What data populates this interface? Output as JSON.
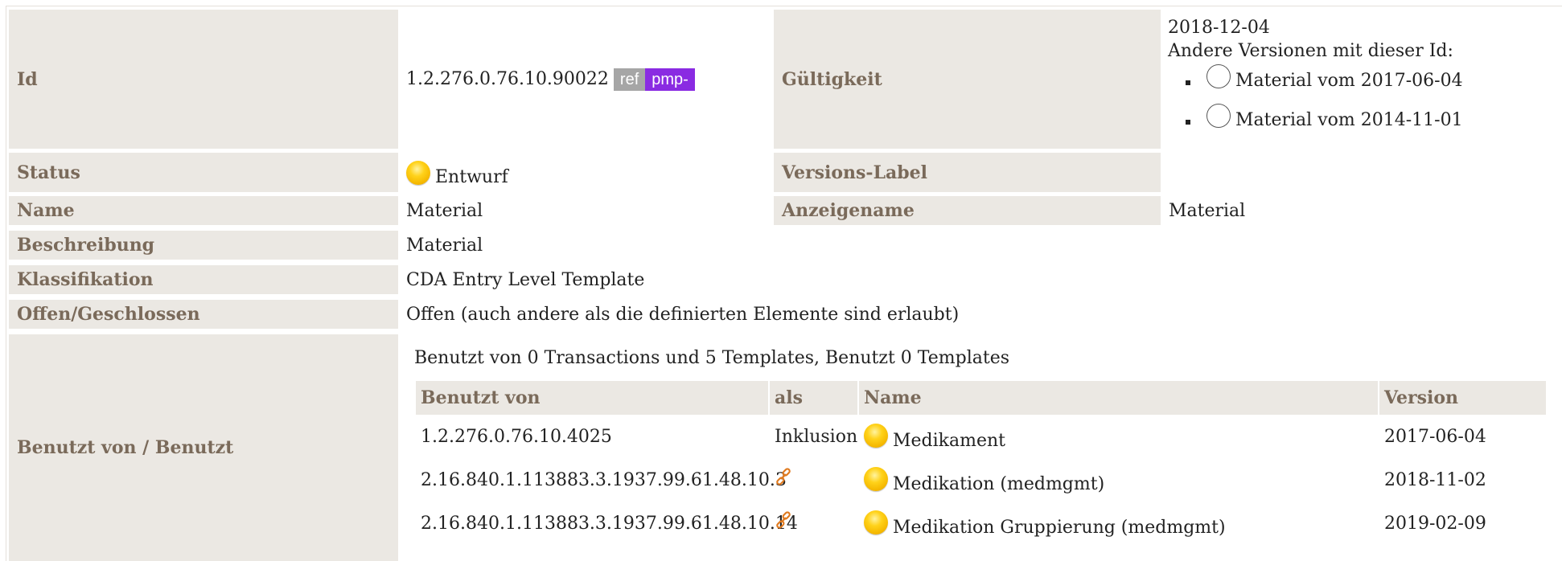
{
  "id_row": {
    "label": "Id",
    "value": "1.2.276.0.76.10.90022",
    "badges": [
      "ref",
      "pmp-"
    ]
  },
  "validity": {
    "label": "Gültigkeit",
    "date": "2018-12-04",
    "other_versions_label": "Andere Versionen mit dieser Id:",
    "versions": [
      "Material vom 2017-06-04",
      "Material vom 2014-11-01"
    ]
  },
  "status": {
    "label": "Status",
    "value": "Entwurf"
  },
  "version_label": {
    "label": "Versions-Label",
    "value": ""
  },
  "name": {
    "label": "Name",
    "value": "Material"
  },
  "display_name": {
    "label": "Anzeigename",
    "value": "Material"
  },
  "description": {
    "label": "Beschreibung",
    "value": "Material"
  },
  "classification": {
    "label": "Klassifikation",
    "value": "CDA Entry Level Template"
  },
  "open_closed": {
    "label": "Offen/Geschlossen",
    "value": "Offen (auch andere als die definierten Elemente sind erlaubt)"
  },
  "used_by": {
    "label": "Benutzt von / Benutzt",
    "summary": "Benutzt von 0 Transactions und 5 Templates, Benutzt 0 Templates",
    "columns": [
      "Benutzt von",
      "als",
      "Name",
      "Version"
    ],
    "rows": [
      {
        "id": "1.2.276.0.76.10.4025",
        "as": "Inklusion",
        "name": "Medikament",
        "version": "2017-06-04"
      },
      {
        "id": "2.16.840.1.113883.3.1937.99.61.48.10.3",
        "as": "",
        "name": "Medikation (medmgmt)",
        "version": "2018-11-02"
      },
      {
        "id": "2.16.840.1.113883.3.1937.99.61.48.10.14",
        "as": "",
        "name": "Medikation Gruppierung (medmgmt)",
        "version": "2019-02-09"
      }
    ]
  },
  "colors": {
    "label_bg": "#ebe8e3",
    "label_text": "#7a6a5a",
    "status_draft": "#ffd21a",
    "link": "#e07a1f",
    "pmp_badge": "#8a2be2",
    "ref_badge": "#a6a6a6"
  }
}
